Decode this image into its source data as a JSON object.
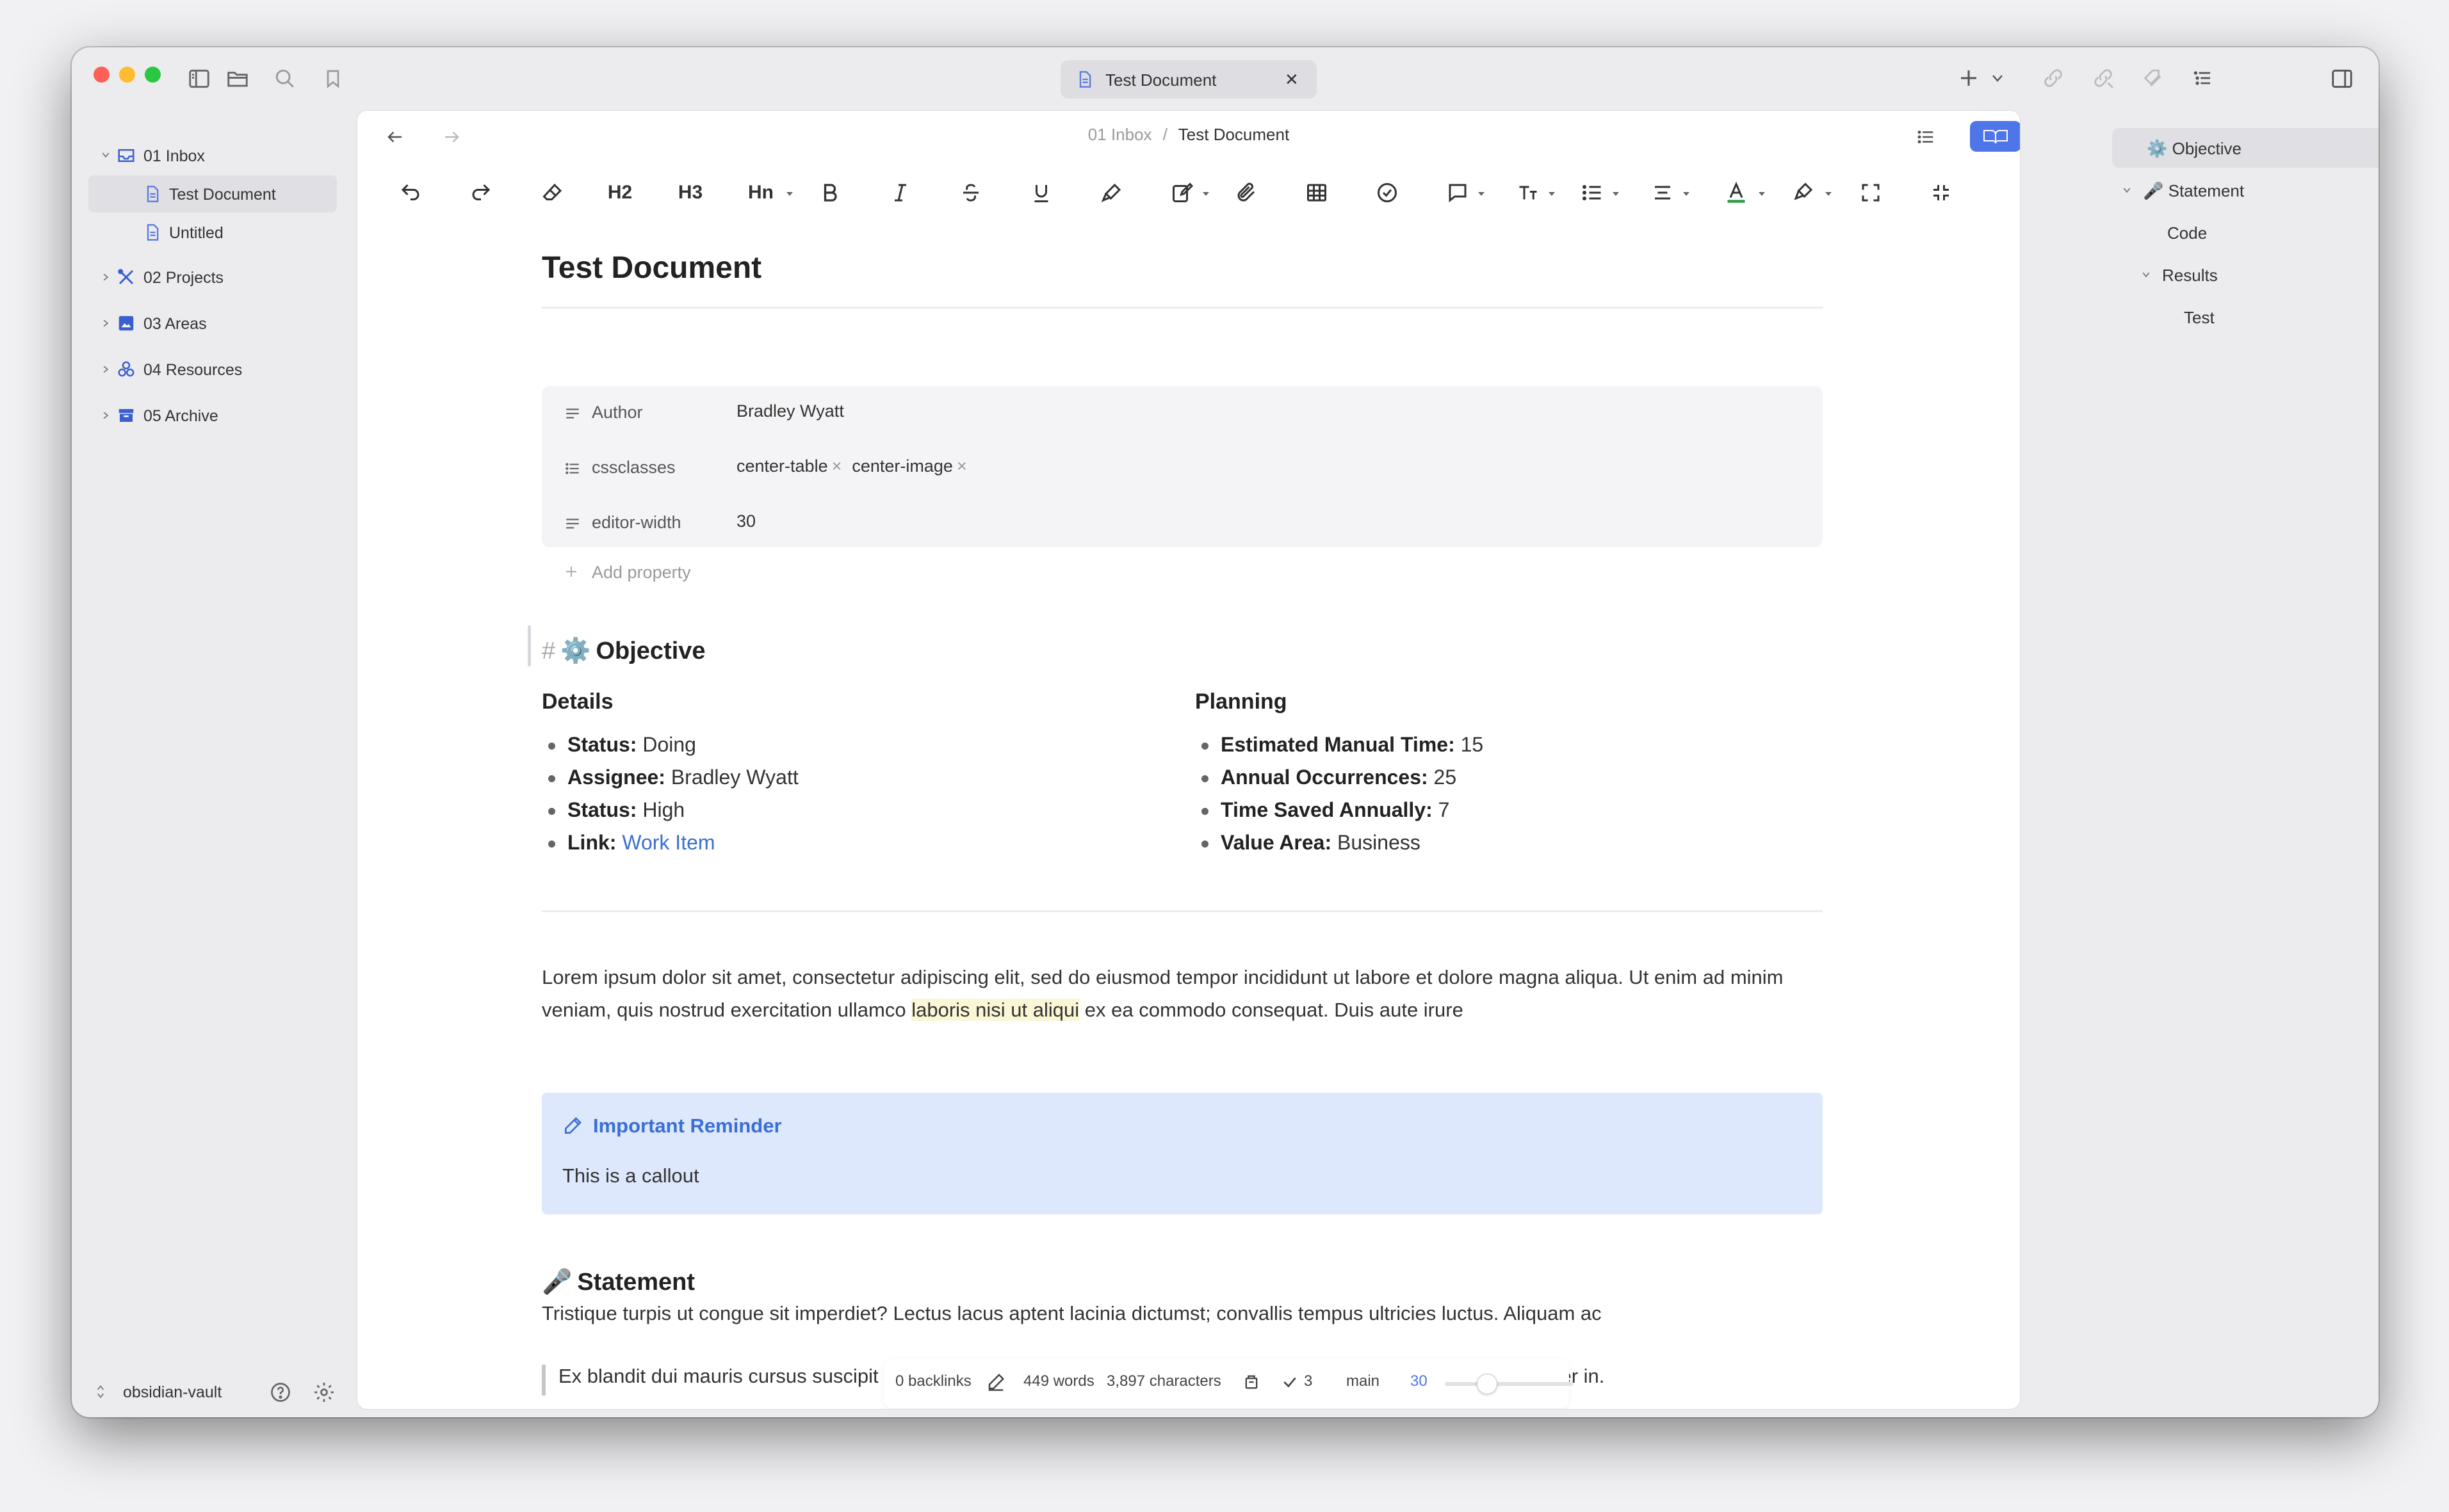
{
  "window": {
    "tab_title": "Test Document",
    "tab_close": "✕"
  },
  "colors": {
    "accent": "#4f76e8",
    "link": "#3a6fd3",
    "callout_bg": "#dde8fc",
    "highlight": "#fbf6d6"
  },
  "sidebar": {
    "items": [
      {
        "label": "01 Inbox",
        "icon": "inbox-icon",
        "expanded": true
      },
      {
        "label": "Test Document",
        "icon": "file-icon",
        "selected": true
      },
      {
        "label": "Untitled",
        "icon": "file-icon"
      },
      {
        "label": "02 Projects",
        "icon": "tools-icon"
      },
      {
        "label": "03 Areas",
        "icon": "picture-icon"
      },
      {
        "label": "04 Resources",
        "icon": "cluster-icon"
      },
      {
        "label": "05 Archive",
        "icon": "archive-icon"
      }
    ],
    "vault_name": "obsidian-vault"
  },
  "editor": {
    "breadcrumb": {
      "folder": "01 Inbox",
      "separator": "/",
      "file": "Test Document"
    },
    "toolbar": {
      "h2": "H2",
      "h3": "H3",
      "hn": "Hn"
    },
    "title": "Test Document",
    "properties": [
      {
        "key": "Author",
        "value": "Bradley Wyatt",
        "icon": "text-lines-icon"
      },
      {
        "key": "cssclasses",
        "values": [
          "center-table",
          "center-image"
        ],
        "icon": "list-icon"
      },
      {
        "key": "editor-width",
        "value": "30",
        "icon": "text-lines-icon"
      }
    ],
    "add_property": "Add property",
    "remove_symbol": "×",
    "objective_heading": {
      "hash": "#",
      "emoji": "⚙️",
      "text": "Objective"
    },
    "details": {
      "heading": "Details",
      "items": [
        {
          "label": "Status:",
          "value": "Doing"
        },
        {
          "label": "Assignee:",
          "value": "Bradley Wyatt"
        },
        {
          "label": "Status:",
          "value": "High"
        },
        {
          "label": "Link:",
          "value": "Work Item"
        }
      ]
    },
    "planning": {
      "heading": "Planning",
      "items": [
        {
          "label": "Estimated Manual Time:",
          "value": "15"
        },
        {
          "label": "Annual Occurrences:",
          "value": "25"
        },
        {
          "label": "Time Saved Annually:",
          "value": "7"
        },
        {
          "label": "Value Area:",
          "value": "Business"
        }
      ]
    },
    "paragraph": {
      "before": "Lorem ipsum dolor sit amet, consectetur adipiscing elit, sed do eiusmod tempor incididunt ut labore et dolore magna aliqua. Ut enim ad minim veniam, quis nostrud exercitation ullamco ",
      "highlight": "laboris nisi ut aliqui",
      "after": " ex ea commodo consequat. Duis aute irure"
    },
    "callout": {
      "title": "Important Reminder",
      "body": "This is a callout"
    },
    "statement_heading": {
      "emoji": "🎤",
      "text": "Statement"
    },
    "statement_text": "Tristique turpis ut congue sit imperdiet? Lectus lacus aptent lacinia dictumst; convallis tempus ultricies luctus. Aliquam ac",
    "blockquote": "Ex blandit dui mauris cursus suscipit nisl convallis. Cras aliquet condimentum facilisi aliquam purus velit non semper in."
  },
  "status_bar": {
    "backlinks": "0 backlinks",
    "words": "449 words",
    "characters": "3,897 characters",
    "tasks": "3",
    "branch": "main",
    "width_value": "30",
    "width_slider_fraction": 0.33
  },
  "outline": {
    "items": [
      {
        "label": "⚙️ Objective",
        "selected": true
      },
      {
        "label": "🎤 Statement",
        "expanded": true
      },
      {
        "label": "Code"
      },
      {
        "label": "Results",
        "expanded": true
      },
      {
        "label": "Test"
      }
    ]
  }
}
